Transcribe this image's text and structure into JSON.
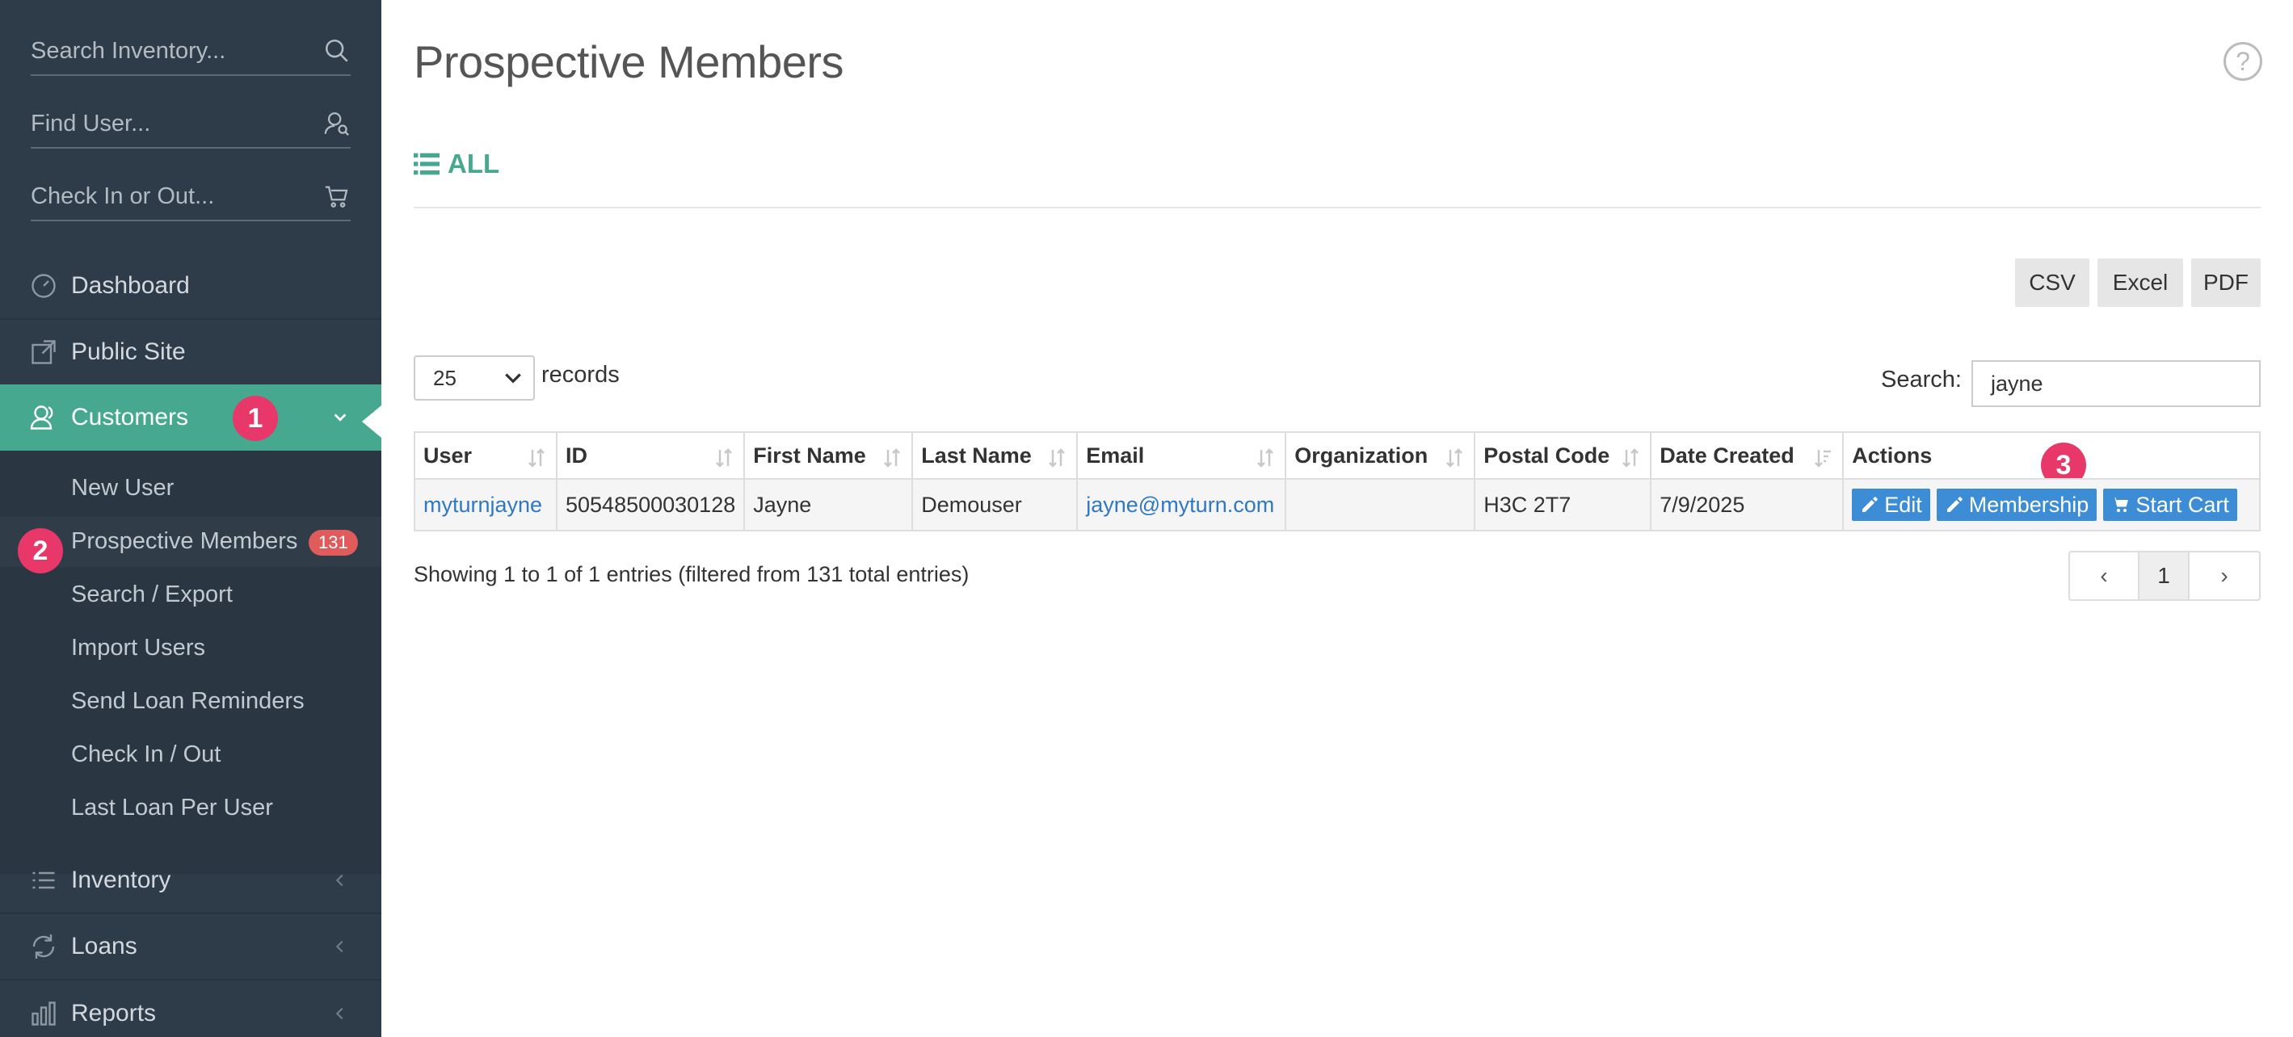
{
  "sidebar": {
    "search_inventory_placeholder": "Search Inventory...",
    "find_user_placeholder": "Find User...",
    "check_in_out_placeholder": "Check In or Out...",
    "nav": {
      "dashboard": "Dashboard",
      "public_site": "Public Site",
      "customers": "Customers",
      "inventory": "Inventory",
      "loans": "Loans",
      "reports": "Reports"
    },
    "customers_submenu": {
      "new_user": "New User",
      "prospective_members": "Prospective Members",
      "prospective_members_count": "131",
      "search_export": "Search / Export",
      "import_users": "Import Users",
      "send_loan_reminders": "Send Loan Reminders",
      "check_in_out": "Check In / Out",
      "last_loan_per_user": "Last Loan Per User"
    }
  },
  "markers": {
    "m1": "1",
    "m2": "2",
    "m3": "3"
  },
  "main": {
    "title": "Prospective Members",
    "help": "?",
    "filter_all": "ALL",
    "export": {
      "csv": "CSV",
      "excel": "Excel",
      "pdf": "PDF"
    },
    "length_value": "25",
    "records_label": "records",
    "search_label": "Search:",
    "search_value": "jayne",
    "columns": [
      "User",
      "ID",
      "First Name",
      "Last Name",
      "Email",
      "Organization",
      "Postal Code",
      "Date Created",
      "Actions"
    ],
    "row": {
      "user": "myturnjayne",
      "id": "50548500030128",
      "first_name": "Jayne",
      "last_name": "Demouser",
      "email": "jayne@myturn.com",
      "organization": "",
      "postal_code": "H3C 2T7",
      "date_created": "7/9/2025"
    },
    "actions": {
      "edit": "Edit",
      "membership": "Membership",
      "start_cart": "Start Cart"
    },
    "info": "Showing 1 to 1 of 1 entries (filtered from 131 total entries)",
    "pager": {
      "prev": "‹",
      "current": "1",
      "next": "›"
    }
  },
  "colors": {
    "sidebar_bg": "#2e3b48",
    "accent_green": "#45a88f",
    "marker_pink": "#e8386a",
    "badge_red": "#e05b5b",
    "action_blue": "#3c8dd6",
    "link_blue": "#2f78c2"
  }
}
